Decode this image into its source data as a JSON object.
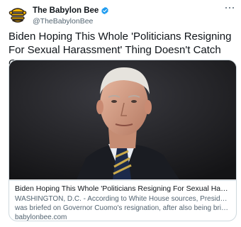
{
  "account": {
    "display_name": "The Babylon Bee",
    "handle": "@TheBabylonBee",
    "avatar_icon": "babylon-bee-logo-icon",
    "verified_icon": "verified-badge-icon",
    "verified_color": "#1d9bf0"
  },
  "tweet": {
    "text": "Biden Hoping This Whole 'Politicians Resigning For Sexual Harassment' Thing Doesn't Catch On",
    "more_icon": "more-options-icon"
  },
  "card": {
    "image": "photo-of-joe-biden",
    "title": "Biden Hoping This Whole 'Politicians Resigning For Sexual Harassment' Thi...",
    "description_line1": "WASHINGTON, D.C. - According to White House sources, President Biden",
    "description_line2": "was briefed on Governor Cuomo's resignation, after also being briefed on ...",
    "domain": "babylonbee.com"
  }
}
